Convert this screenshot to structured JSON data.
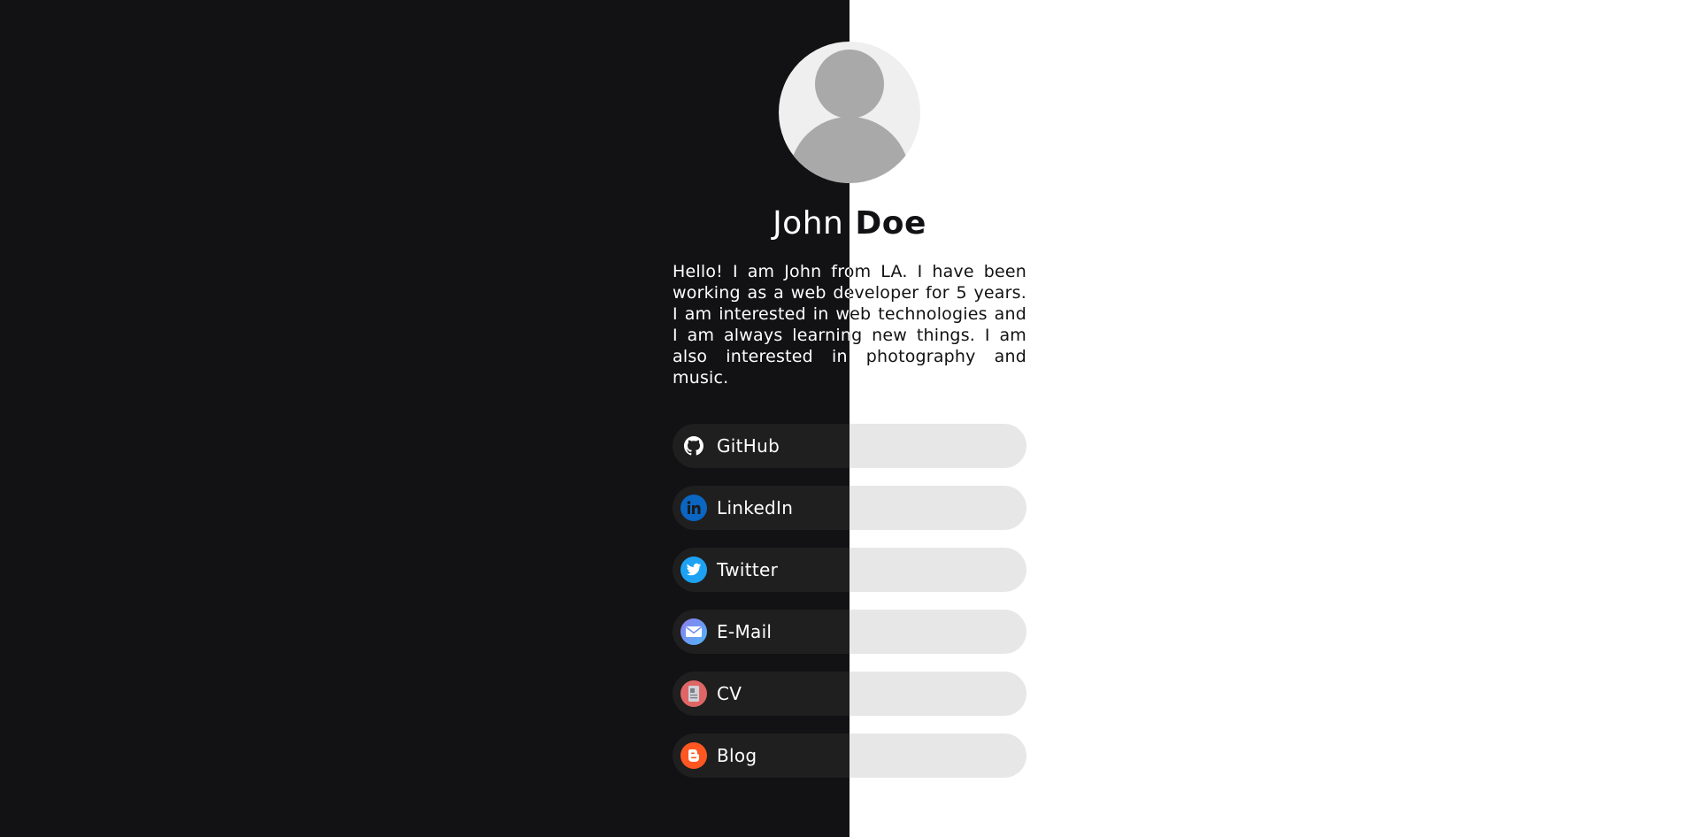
{
  "profile": {
    "first_name": "John",
    "last_name": "Doe",
    "bio": "Hello! I am John from LA. I have been working as a web developer for 5 years. I am interested in web technologies and I am always learning new things. I am also interested in photography and music."
  },
  "links": [
    {
      "label": "GitHub",
      "icon": "github-icon",
      "color": "#ffffff"
    },
    {
      "label": "LinkedIn",
      "icon": "linkedin-icon",
      "color": "#0a66c2"
    },
    {
      "label": "Twitter",
      "icon": "twitter-icon",
      "color": "#1da1f2"
    },
    {
      "label": "E-Mail",
      "icon": "mail-icon",
      "color": "#5b8def"
    },
    {
      "label": "CV",
      "icon": "document-icon",
      "color": "#e06666"
    },
    {
      "label": "Blog",
      "icon": "blogger-icon",
      "color": "#ff5722"
    }
  ],
  "theme": {
    "dark_bg": "#121214",
    "light_bg": "#ffffff",
    "dark_button": "#1f1f1f",
    "light_button": "#e7e7e7"
  }
}
